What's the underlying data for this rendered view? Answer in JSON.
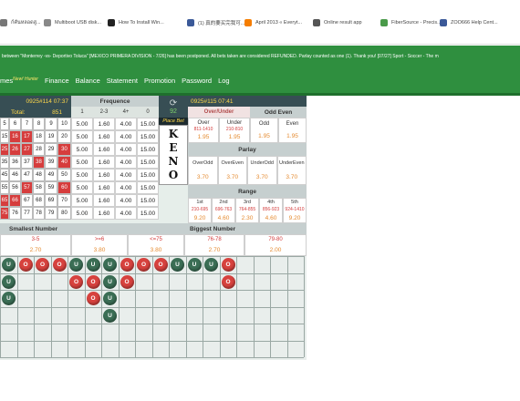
{
  "bookmarks": [
    {
      "label": "ก์คันหลอดสู...",
      "icon": "page-icon",
      "color": "#777777"
    },
    {
      "label": "Multiboot USB disk...",
      "icon": "file-icon",
      "color": "#888888"
    },
    {
      "label": "How To Install Win...",
      "icon": "g-icon",
      "color": "#222222"
    },
    {
      "label": "(1) 真的要买完我可...",
      "icon": "facebook-icon",
      "color": "#3b5998"
    },
    {
      "label": "April 2013 « Everyt...",
      "icon": "blogger-icon",
      "color": "#f57d00"
    },
    {
      "label": "Online result app",
      "icon": "globe-icon",
      "color": "#555555"
    },
    {
      "label": "FiberSource - Precis...",
      "icon": "swirl-icon",
      "color": "#4a9a4a"
    },
    {
      "label": "ZOO666 Help Cent...",
      "icon": "facebook-icon",
      "color": "#3b5998"
    }
  ],
  "ticker": "between \"Monterrey -vs- Deportivo Toluca\" [MEXICO PRIMERA DIVISION - 7/26] has been postponed. All bets taken are considered REFUNDED. Parlay counted as one (1). Thank you!     [07/27] Sport - Soccer - The m",
  "nav": {
    "items": [
      "mes",
      "Finance",
      "Balance",
      "Statement",
      "Promotion",
      "Password",
      "Log"
    ],
    "sup": "New! Hunter"
  },
  "game": {
    "left_draw": "0925#114 07:37",
    "total_label": "Total:",
    "total_value": "851",
    "right_draw": "0925#115 07:41",
    "countdown": "92",
    "place_bet": "Place Bet",
    "keno_letters": [
      "K",
      "E",
      "N",
      "O"
    ],
    "frequence": {
      "title": "Frequence",
      "cols": [
        "1",
        "2-3",
        "4+",
        "0"
      ],
      "rows": [
        [
          "5.00",
          "1.60",
          "4.00",
          "15.00"
        ],
        [
          "5.00",
          "1.60",
          "4.00",
          "15.00"
        ],
        [
          "5.00",
          "1.60",
          "4.00",
          "15.00"
        ],
        [
          "5.00",
          "1.60",
          "4.00",
          "15.00"
        ],
        [
          "5.00",
          "1.60",
          "4.00",
          "15.00"
        ],
        [
          "5.00",
          "1.60",
          "4.00",
          "15.00"
        ],
        [
          "5.00",
          "1.60",
          "4.00",
          "15.00"
        ],
        [
          "5.00",
          "1.60",
          "4.00",
          "15.00"
        ]
      ]
    },
    "board": [
      [
        "5",
        "6",
        "7",
        "8",
        "9",
        "10"
      ],
      [
        "15",
        "16",
        "17",
        "18",
        "19",
        "20"
      ],
      [
        "25",
        "26",
        "27",
        "28",
        "29",
        "30"
      ],
      [
        "35",
        "36",
        "37",
        "38",
        "39",
        "40"
      ],
      [
        "45",
        "46",
        "47",
        "48",
        "49",
        "50"
      ],
      [
        "55",
        "56",
        "57",
        "58",
        "59",
        "60"
      ],
      [
        "65",
        "66",
        "67",
        "68",
        "69",
        "70"
      ],
      [
        "75",
        "76",
        "77",
        "78",
        "79",
        "80"
      ]
    ],
    "board_red": [
      [
        1,
        1
      ],
      [
        1,
        2
      ],
      [
        2,
        0
      ],
      [
        2,
        1
      ],
      [
        2,
        2
      ],
      [
        2,
        5
      ],
      [
        3,
        3
      ],
      [
        3,
        5
      ],
      [
        5,
        2
      ],
      [
        5,
        5
      ],
      [
        6,
        0
      ],
      [
        6,
        1
      ],
      [
        7,
        0
      ]
    ],
    "over_under": {
      "title": "Over/Under",
      "cols": [
        "Over",
        "Under"
      ],
      "ranges": [
        "811-1410",
        "210-810"
      ],
      "odds": [
        "1.95",
        "1.95"
      ]
    },
    "odd_even": {
      "title": "Odd Even",
      "cols": [
        "Odd",
        "Even"
      ],
      "odds": [
        "1.95",
        "1.95"
      ]
    },
    "parlay": {
      "title": "Parlay",
      "cols": [
        "OverOdd",
        "OverEven",
        "UnderOdd",
        "UnderEven"
      ],
      "odds": [
        "3.70",
        "3.70",
        "3.70",
        "3.70"
      ]
    },
    "range": {
      "title": "Range",
      "cols": [
        "1st",
        "2nd",
        "3rd",
        "4th",
        "5th"
      ],
      "ranges": [
        "210-695",
        "696-763",
        "764-855",
        "856-923",
        "924-1410"
      ],
      "odds": [
        "9.20",
        "4.60",
        "2.30",
        "4.60",
        "9.20"
      ]
    },
    "smallest": {
      "title": "Smallest Number",
      "cols": [
        "3-5",
        ">=6"
      ],
      "odds": [
        "2.70",
        "3.80"
      ]
    },
    "biggest": {
      "title": "Biggest Number",
      "cols": [
        "<=75",
        "76-78",
        "79-80"
      ],
      "odds": [
        "3.80",
        "2.70",
        "2.00"
      ]
    },
    "history": [
      [
        "U",
        "U",
        "U"
      ],
      [
        "O"
      ],
      [
        "O"
      ],
      [
        "O"
      ],
      [
        "U",
        "O"
      ],
      [
        "U",
        "O",
        "O"
      ],
      [
        "U",
        "U",
        "U",
        "U"
      ],
      [
        "O",
        "O"
      ],
      [
        "O"
      ],
      [
        "O"
      ],
      [
        "U"
      ],
      [
        "U"
      ],
      [
        "U"
      ],
      [
        "O",
        "O"
      ]
    ]
  },
  "colors": {
    "green": "#2f8f3f",
    "red": "#d63d3d",
    "dark": "#374e54",
    "circle_over": "#d7423e",
    "circle_under": "#3b6e55"
  }
}
